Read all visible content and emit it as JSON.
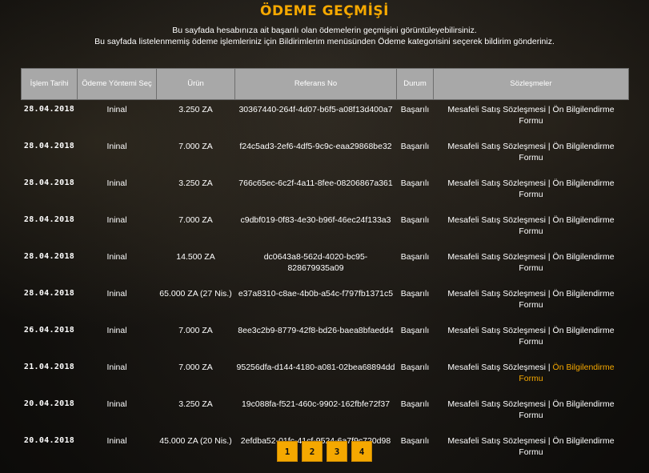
{
  "page": {
    "title": "ÖDEME GEÇMİŞİ",
    "desc_line1": "Bu sayfada hesabınıza ait başarılı olan ödemelerin geçmişini görüntüleyebilirsiniz.",
    "desc_line2": "Bu sayfada listelenmemiş ödeme işlemleriniz için Bildirimlerim menüsünden Ödeme kategorisini seçerek bildirim gönderiniz."
  },
  "table": {
    "headers": {
      "date": "İşlem Tarihi",
      "method": "Ödeme Yöntemi Seç",
      "product": "Ürün",
      "reference": "Referans No",
      "status": "Durum",
      "contracts": "Sözleşmeler"
    },
    "rows": [
      {
        "date": "28.04.2018",
        "method": "Ininal",
        "product": "3.250 ZA",
        "reference": "30367440-264f-4d07-b6f5-a08f13d400a7",
        "status": "Başarılı",
        "link1": "Mesafeli Satış Sözleşmesi",
        "sep": " | ",
        "link2": "Ön Bilgilendirme Formu"
      },
      {
        "date": "28.04.2018",
        "method": "Ininal",
        "product": "7.000 ZA",
        "reference": "f24c5ad3-2ef6-4df5-9c9c-eaa29868be32",
        "status": "Başarılı",
        "link1": "Mesafeli Satış Sözleşmesi",
        "sep": " | ",
        "link2": "Ön Bilgilendirme Formu"
      },
      {
        "date": "28.04.2018",
        "method": "Ininal",
        "product": "3.250 ZA",
        "reference": "766c65ec-6c2f-4a11-8fee-08206867a361",
        "status": "Başarılı",
        "link1": "Mesafeli Satış Sözleşmesi",
        "sep": " | ",
        "link2": "Ön Bilgilendirme Formu"
      },
      {
        "date": "28.04.2018",
        "method": "Ininal",
        "product": "7.000 ZA",
        "reference": "c9dbf019-0f83-4e30-b96f-46ec24f133a3",
        "status": "Başarılı",
        "link1": "Mesafeli Satış Sözleşmesi",
        "sep": " | ",
        "link2": "Ön Bilgilendirme Formu"
      },
      {
        "date": "28.04.2018",
        "method": "Ininal",
        "product": "14.500 ZA",
        "reference": "dc0643a8-562d-4020-bc95-828679935a09",
        "status": "Başarılı",
        "link1": "Mesafeli Satış Sözleşmesi",
        "sep": " | ",
        "link2": "Ön Bilgilendirme Formu"
      },
      {
        "date": "28.04.2018",
        "method": "Ininal",
        "product": "65.000 ZA (27 Nis.)",
        "reference": "e37a8310-c8ae-4b0b-a54c-f797fb1371c5",
        "status": "Başarılı",
        "link1": "Mesafeli Satış Sözleşmesi",
        "sep": " | ",
        "link2": "Ön Bilgilendirme Formu"
      },
      {
        "date": "26.04.2018",
        "method": "Ininal",
        "product": "7.000 ZA",
        "reference": "8ee3c2b9-8779-42f8-bd26-baea8bfaedd4",
        "status": "Başarılı",
        "link1": "Mesafeli Satış Sözleşmesi",
        "sep": " | ",
        "link2": "Ön Bilgilendirme Formu"
      },
      {
        "date": "21.04.2018",
        "method": "Ininal",
        "product": "7.000 ZA",
        "reference": "95256dfa-d144-4180-a081-02bea68894dd",
        "status": "Başarılı",
        "link1": "Mesafeli Satış Sözleşmesi",
        "sep": " | ",
        "link2": "Ön Bilgilendirme Formu"
      },
      {
        "date": "20.04.2018",
        "method": "Ininal",
        "product": "3.250 ZA",
        "reference": "19c088fa-f521-460c-9902-162fbfe72f37",
        "status": "Başarılı",
        "link1": "Mesafeli Satış Sözleşmesi",
        "sep": " | ",
        "link2": "Ön Bilgilendirme Formu"
      },
      {
        "date": "20.04.2018",
        "method": "Ininal",
        "product": "45.000 ZA (20 Nis.)",
        "reference": "2efdba52-01fc-41cf-9524-6a7f9c720d98",
        "status": "Başarılı",
        "link1": "Mesafeli Satış Sözleşmesi",
        "sep": " | ",
        "link2": "Ön Bilgilendirme Formu"
      }
    ],
    "highlighted_row": 7
  },
  "pagination": [
    "1",
    "2",
    "3",
    "4"
  ],
  "colors": {
    "accent": "#f5a800",
    "header_bg": "#a8a8a8",
    "background": "#151310"
  }
}
